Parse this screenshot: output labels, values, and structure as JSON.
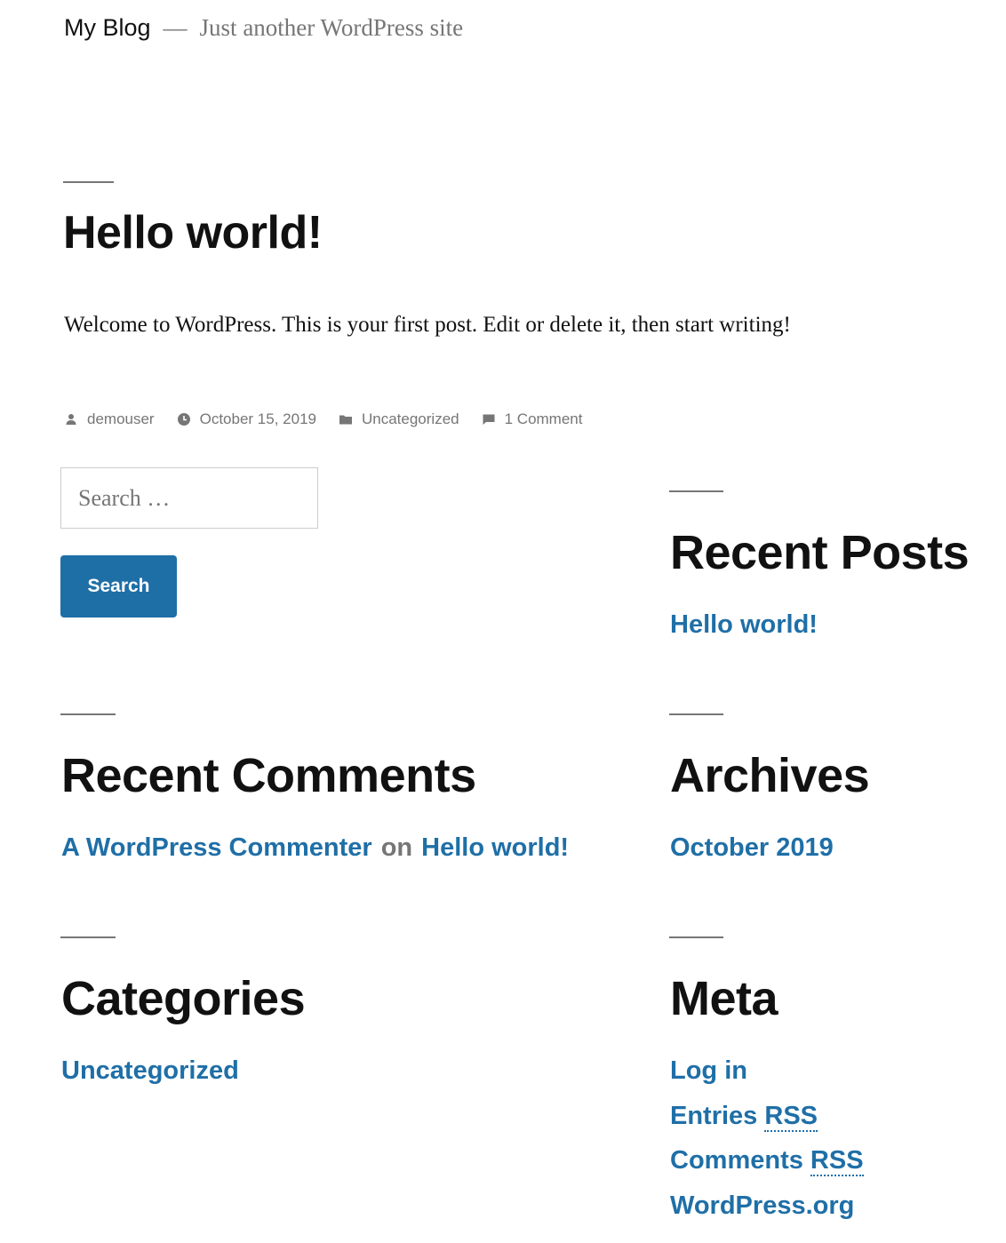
{
  "header": {
    "site_title": "My Blog",
    "separator": "—",
    "tagline": "Just another WordPress site"
  },
  "post": {
    "title": "Hello world!",
    "content": "Welcome to WordPress. This is your first post. Edit or delete it, then start writing!",
    "meta": {
      "author": "demouser",
      "date": "October 15, 2019",
      "category": "Uncategorized",
      "comments": "1 Comment"
    }
  },
  "search": {
    "placeholder": "Search …",
    "button_label": "Search"
  },
  "widgets": {
    "recent_posts": {
      "title": "Recent Posts",
      "items": [
        "Hello world!"
      ]
    },
    "recent_comments": {
      "title": "Recent Comments",
      "author": "A WordPress Commenter",
      "connector": "on",
      "post": "Hello world!"
    },
    "archives": {
      "title": "Archives",
      "items": [
        "October 2019"
      ]
    },
    "categories": {
      "title": "Categories",
      "items": [
        "Uncategorized"
      ]
    },
    "meta": {
      "title": "Meta",
      "log_in": "Log in",
      "entries_prefix": "Entries",
      "comments_prefix": "Comments",
      "rss": "RSS",
      "wordpress_org": "WordPress.org"
    }
  },
  "colors": {
    "link": "#1f6fa7",
    "muted": "#767676",
    "text": "#111111",
    "button": "#1f6fa7"
  },
  "icons": {
    "author": "person-icon",
    "date": "clock-icon",
    "category": "folder-icon",
    "comments": "comment-icon"
  }
}
